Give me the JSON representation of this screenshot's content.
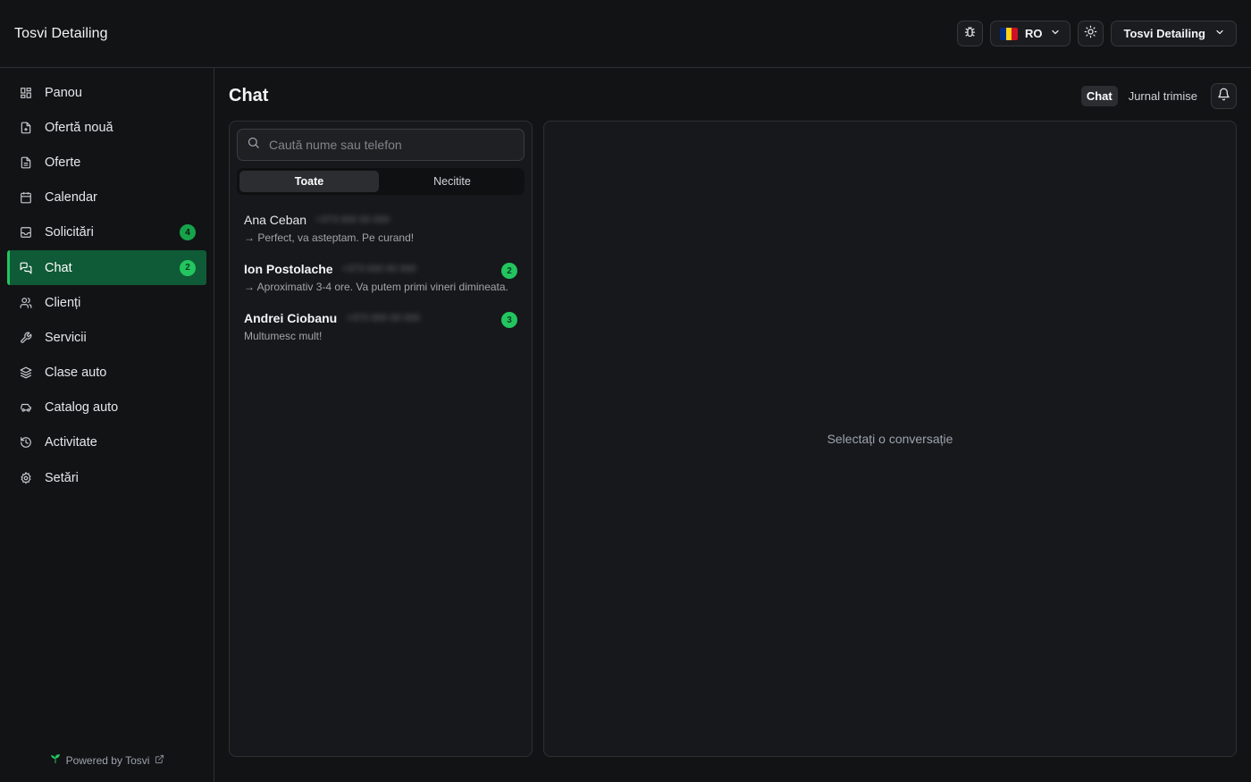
{
  "app": {
    "brand": "Tosvi Detailing",
    "language": "RO",
    "account": "Tosvi Detailing",
    "flag_colors": [
      "#002B7F",
      "#FCD116",
      "#CE1126"
    ]
  },
  "sidebar": {
    "items": [
      {
        "label": "Panou",
        "icon": "dashboard-icon"
      },
      {
        "label": "Ofertă nouă",
        "icon": "file-plus-icon"
      },
      {
        "label": "Oferte",
        "icon": "file-text-icon"
      },
      {
        "label": "Calendar",
        "icon": "calendar-icon"
      },
      {
        "label": "Solicitări",
        "icon": "inbox-icon",
        "badge": "4"
      },
      {
        "label": "Chat",
        "icon": "messages-icon",
        "badge": "2",
        "active": true
      },
      {
        "label": "Clienți",
        "icon": "users-icon"
      },
      {
        "label": "Servicii",
        "icon": "wrench-icon"
      },
      {
        "label": "Clase auto",
        "icon": "layers-icon"
      },
      {
        "label": "Catalog auto",
        "icon": "car-icon"
      },
      {
        "label": "Activitate",
        "icon": "history-icon"
      },
      {
        "label": "Setări",
        "icon": "gear-icon"
      }
    ],
    "powered_by": "Powered by Tosvi"
  },
  "main": {
    "title": "Chat",
    "tabs": [
      "Chat",
      "Jurnal trimise"
    ],
    "search_placeholder": "Caută nume sau telefon",
    "filters": [
      "Toate",
      "Necitite"
    ],
    "conversations": [
      {
        "name": "Ana Ceban",
        "phone": "+373 000 00 000",
        "preview": "→ Perfect, va asteptam. Pe curand!",
        "unread": false
      },
      {
        "name": "Ion Postolache",
        "phone": "+373 000 00 000",
        "preview": "→ Aproximativ 3-4 ore. Va putem primi vineri dimineata.",
        "unread": true,
        "badge": "2"
      },
      {
        "name": "Andrei Ciobanu",
        "phone": "+373 000 00 000",
        "preview": "Multumesc mult!",
        "unread": true,
        "badge": "3"
      }
    ],
    "empty_state": "Selectați o conversație"
  },
  "colors": {
    "accent": "#22c55e",
    "active_nav_bg": "#0f5a37",
    "background": "#121315"
  }
}
